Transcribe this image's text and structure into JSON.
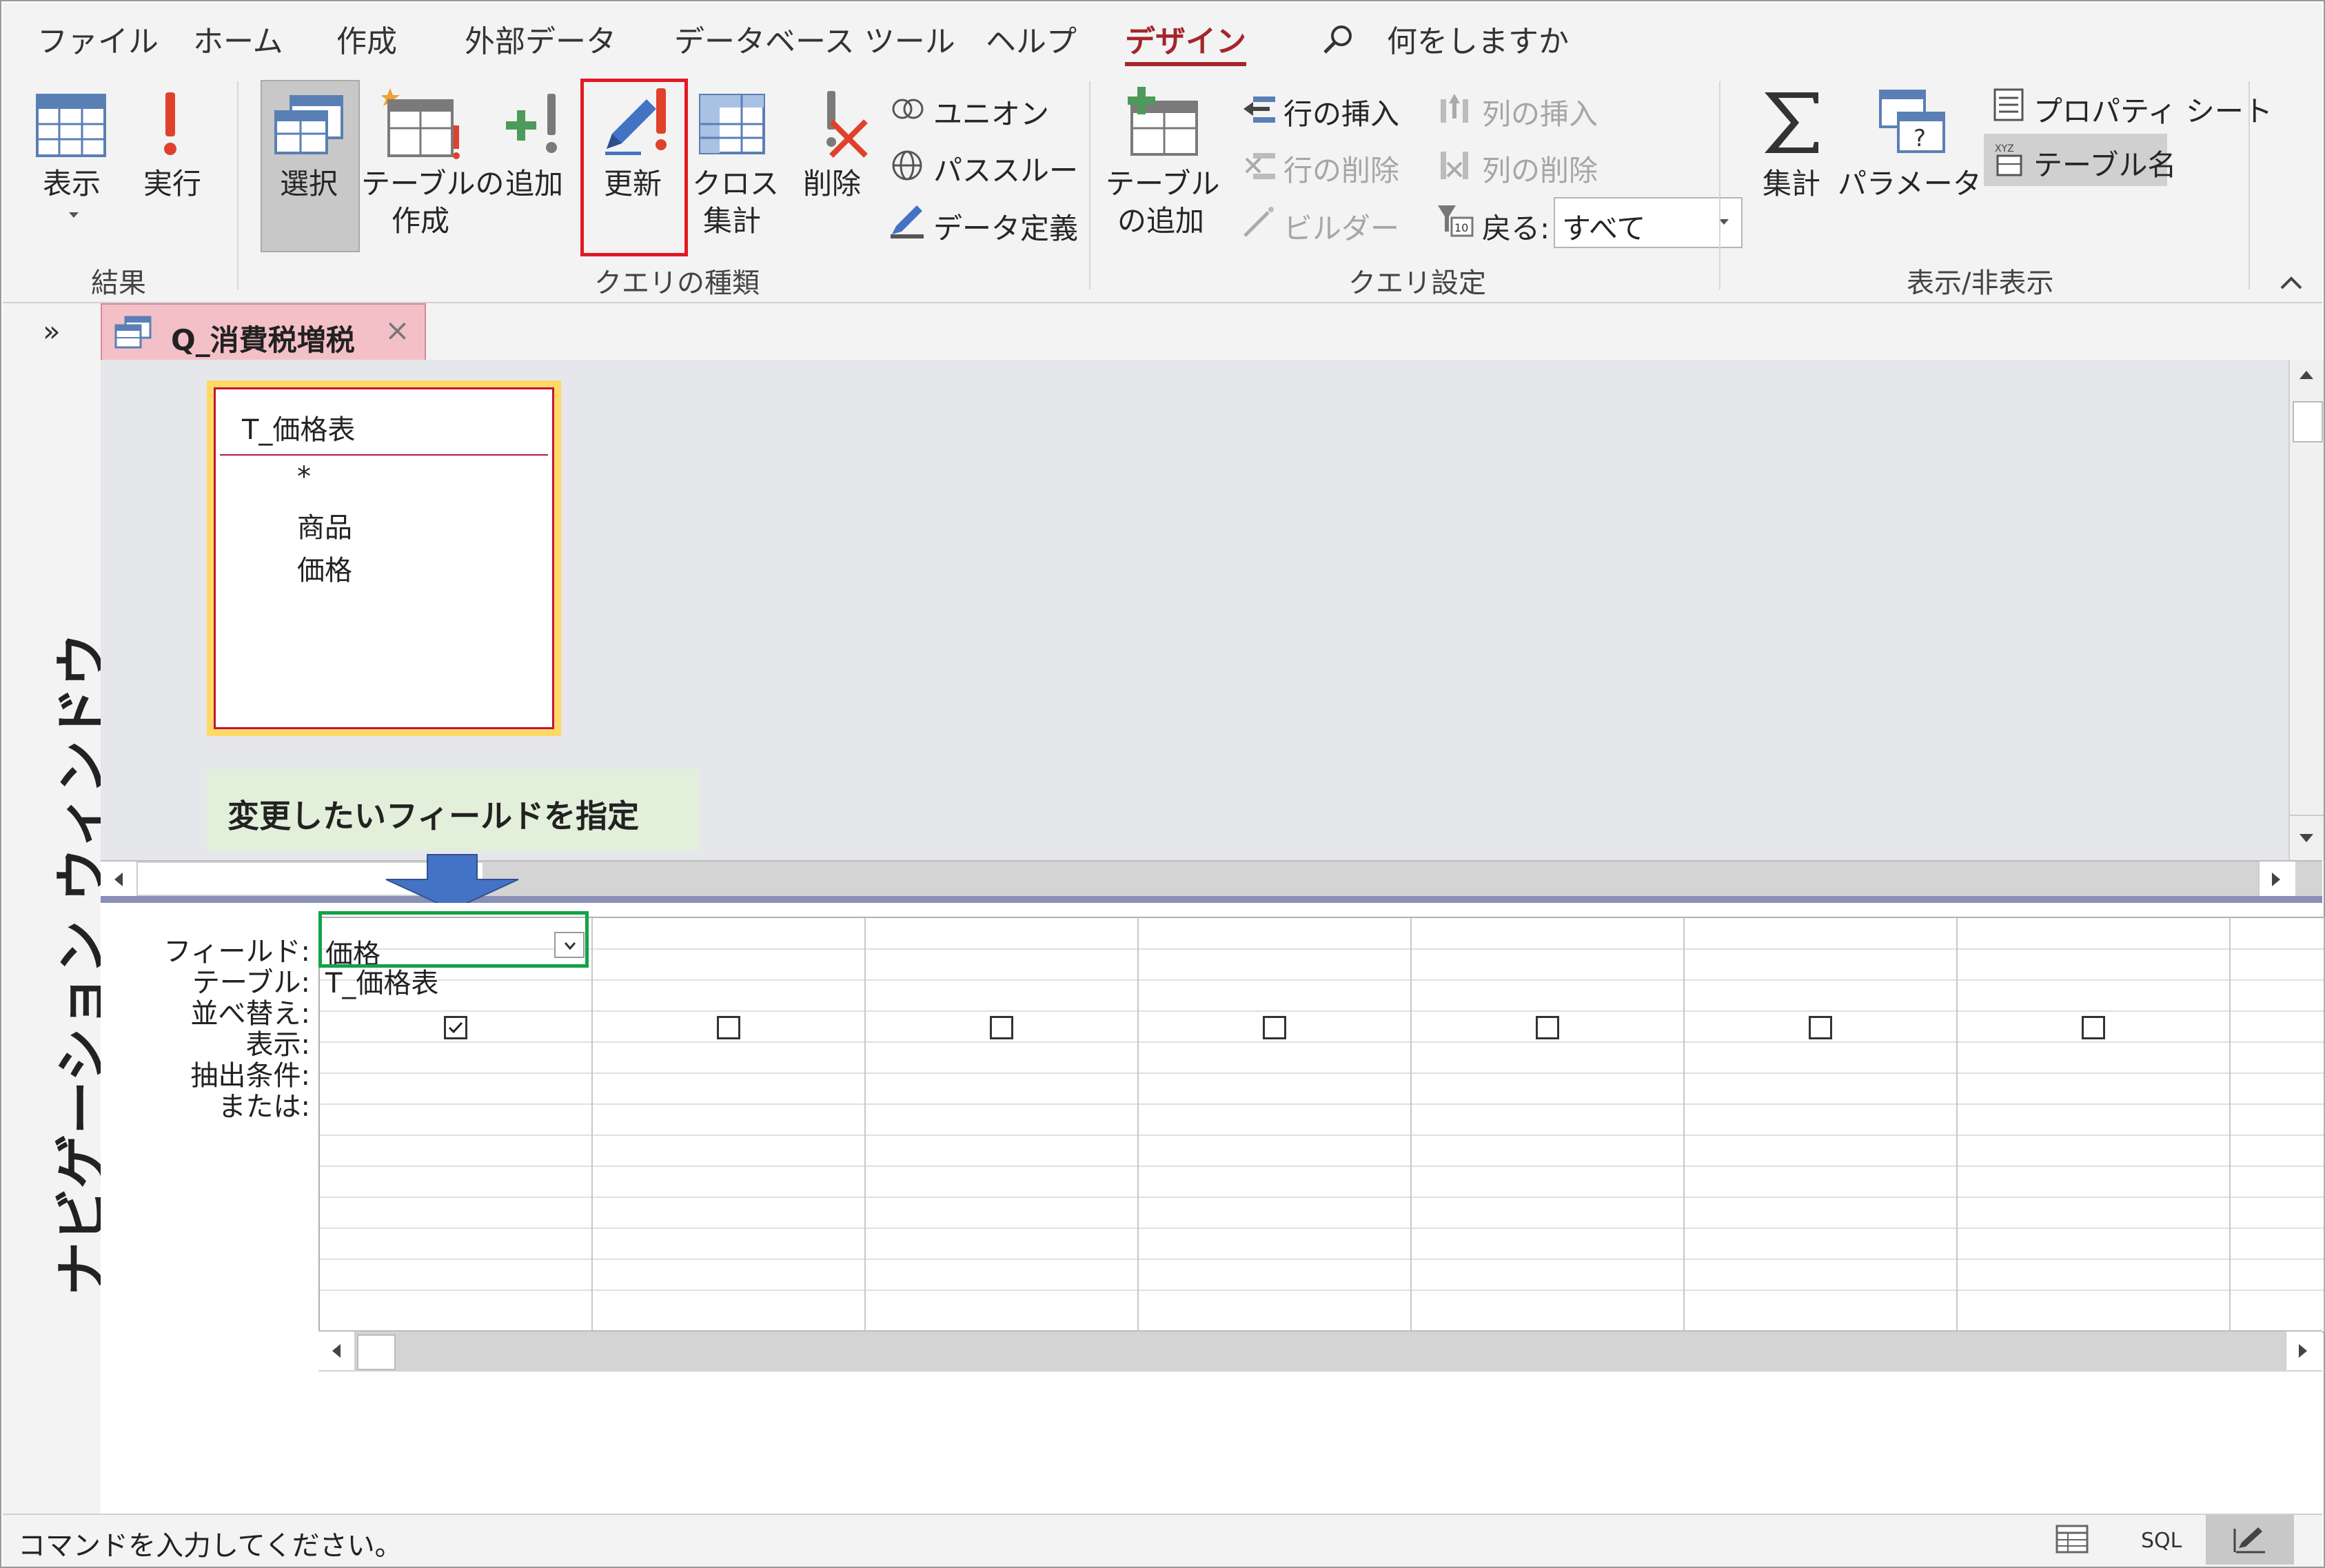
{
  "ribbon_tabs": [
    "ファイル",
    "ホーム",
    "作成",
    "外部データ",
    "データベース ツール",
    "ヘルプ",
    "デザイン"
  ],
  "active_tab": "デザイン",
  "search": {
    "label": "何をしますか"
  },
  "groups": {
    "results": {
      "label": "結果",
      "view": "表示",
      "run": "実行"
    },
    "query_type": {
      "label": "クエリの種類",
      "select": "選択",
      "make_table_1": "テーブルの",
      "make_table_2": "作成",
      "append": "追加",
      "update": "更新",
      "crosstab_1": "クロス",
      "crosstab_2": "集計",
      "delete": "削除",
      "union": "ユニオン",
      "pass_through": "パススルー",
      "data_definition": "データ定義"
    },
    "query_setup": {
      "label": "クエリ設定",
      "add_table_1": "テーブル",
      "add_table_2": "の追加",
      "insert_rows": "行の挿入",
      "delete_rows": "行の削除",
      "builder": "ビルダー",
      "insert_columns": "列の挿入",
      "delete_columns": "列の削除",
      "return_label": "戻る:",
      "return_value": "すべて"
    },
    "show_hide": {
      "label": "表示/非表示",
      "totals": "集計",
      "parameters": "パラメーター",
      "property_sheet": "プロパティ シート",
      "table_names": "テーブル名"
    }
  },
  "nav_pane": {
    "label": "ナビゲーション ウィンドウ",
    "expand": "»"
  },
  "document_tab": {
    "title": "Q_消費税増税",
    "close": "×"
  },
  "field_list": {
    "title": "T_価格表",
    "fields": [
      "*",
      "商品",
      "価格"
    ]
  },
  "callout": "変更したいフィールドを指定",
  "grid": {
    "row_labels": [
      "フィールド:",
      "テーブル:",
      "並べ替え:",
      "表示:",
      "抽出条件:",
      "または:"
    ],
    "columns": [
      {
        "field": "価格",
        "table": "T_価格表",
        "show": true
      },
      {
        "field": "",
        "table": "",
        "show": false
      },
      {
        "field": "",
        "table": "",
        "show": false
      },
      {
        "field": "",
        "table": "",
        "show": false
      },
      {
        "field": "",
        "table": "",
        "show": false
      },
      {
        "field": "",
        "table": "",
        "show": false
      },
      {
        "field": "",
        "table": "",
        "show": false
      }
    ]
  },
  "status_bar": {
    "text": "コマンドを入力してください。",
    "sql": "SQL"
  },
  "colors": {
    "accent": "#a4262c",
    "highlight_red": "#e01b24",
    "highlight_green": "#13a24a",
    "arrow": "#4472c4",
    "callout_bg": "#e2efda",
    "table_box_border": "#ffd966"
  }
}
